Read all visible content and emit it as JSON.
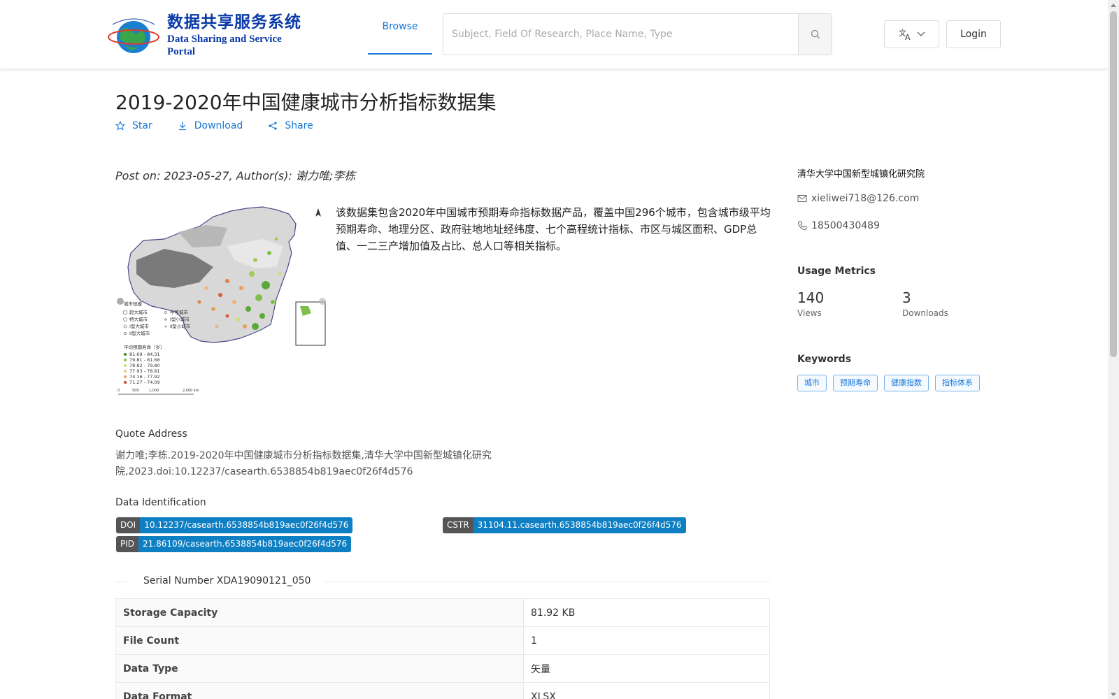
{
  "header": {
    "logo_cn": "数据共享服务系统",
    "logo_en": "Data Sharing and Service Portal",
    "nav_browse": "Browse",
    "search_placeholder": "Subject, Field Of Research, Place Name, Type",
    "login": "Login",
    "icons": {
      "search": "search-icon",
      "language": "translate-icon",
      "dropdown": "chevron-down-icon"
    }
  },
  "dataset": {
    "title": "2019-2020年中国健康城市分析指标数据集",
    "actions": {
      "star": "Star",
      "download": "Download",
      "share": "Share"
    },
    "meta_line": "Post on: 2023-05-27, Author(s): 谢力唯;李栋",
    "description": "该数据集包含2020年中国城市预期寿命指标数据产品，覆盖中国296个城市，包含城市级平均预期寿命、地理分区、政府驻地地址经纬度、七个高程统计指标、市区与城区面积、GDP总值、一二三产增加值及占比、总人口等相关指标。"
  },
  "sidebar": {
    "org": "清华大学中国新型城镇化研究院",
    "email": "xieliwei718@126.com",
    "phone": "18500430489",
    "metrics_title": "Usage Metrics",
    "views": "140",
    "views_label": "Views",
    "downloads": "3",
    "downloads_label": "Downloads",
    "keywords_title": "Keywords",
    "keywords": [
      "城市",
      "预期寿命",
      "健康指数",
      "指标体系"
    ]
  },
  "quote": {
    "title": "Quote Address",
    "text": "谢力唯;李栋.2019-2020年中国健康城市分析指标数据集,清华大学中国新型城镇化研究院,2023.doi:10.12237/casearth.6538854b819aec0f26f4d576"
  },
  "identification": {
    "title": "Data Identification",
    "doi_key": "DOI",
    "doi_val": "10.12237/casearth.6538854b819aec0f26f4d576",
    "cstr_key": "CSTR",
    "cstr_val": "31104.11.casearth.6538854b819aec0f26f4d576",
    "pid_key": "PID",
    "pid_val": "21.86109/casearth.6538854b819aec0f26f4d576"
  },
  "serial": "Serial Number XDA19090121_050",
  "table": [
    {
      "key": "Storage Capacity",
      "value": "81.92 KB"
    },
    {
      "key": "File Count",
      "value": "1"
    },
    {
      "key": "Data Type",
      "value": "矢量"
    },
    {
      "key": "Data Format",
      "value": "XLSX"
    }
  ],
  "map": {
    "legend_size_title": "城市规模",
    "legend_size": [
      "超大城市",
      "特大城市",
      "Ⅰ型大城市",
      "Ⅱ型大城市",
      "中等城市",
      "Ⅰ型小城市",
      "Ⅱ型小城市"
    ],
    "legend_life_title": "平均预期寿命（岁）",
    "legend_life": [
      "81.69 - 84.31",
      "79.81 - 81.68",
      "78.82 - 79.80",
      "77.93 - 78.81",
      "74.16 - 77.92",
      "71.27 - 74.09"
    ],
    "scale": [
      "0",
      "500",
      "1,000",
      "2,000 km"
    ]
  },
  "colors": {
    "accent": "#1677d8",
    "badge_key": "#555555",
    "badge_val": "#0f7fc4"
  }
}
